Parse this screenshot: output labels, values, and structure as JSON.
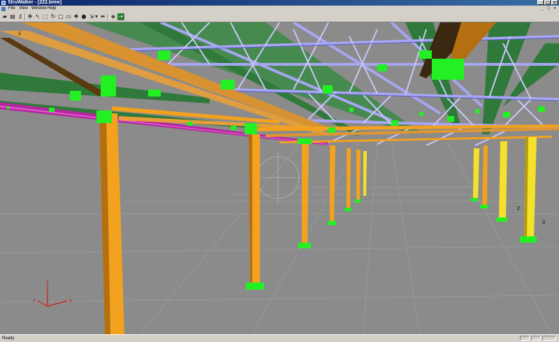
{
  "window": {
    "title": "StruWalker - [222.bmw]",
    "buttons": [
      "_",
      "□",
      "×"
    ]
  },
  "menubar": {
    "items": [
      "File",
      "View",
      "Window",
      "Help"
    ],
    "mdi_buttons": [
      "_",
      "□",
      "×"
    ]
  },
  "toolbar": {
    "icons": [
      "open-icon",
      "print-icon",
      "key-icon",
      "move-icon",
      "select-icon",
      "zoom-window-icon",
      "rotate-icon",
      "box-icon",
      "walk-icon",
      "sphere-icon",
      "shrink-icon",
      "dropdown-icon",
      "measure-icon",
      "next-icon",
      "eraser-icon",
      "walker-icon"
    ],
    "active": "walker-icon"
  },
  "viewport": {
    "gridline_labels": [
      "1",
      "2",
      "3"
    ],
    "axes": {
      "x": "X",
      "y": "Y",
      "z": "Z"
    },
    "colors": {
      "background": "#8b8b8b",
      "column": "#f2a21e",
      "column_dark": "#b36f10",
      "column_bright": "#f4e22a",
      "beam": "#d89232",
      "truss": "#a7a6f2",
      "truss_dark": "#5a5ac0",
      "purlin": "#2f7a3a",
      "connection": "#22f022",
      "magenta_beam": "#b428a0",
      "axis": "#e00000"
    }
  },
  "statusbar": {
    "message": "Ready"
  }
}
